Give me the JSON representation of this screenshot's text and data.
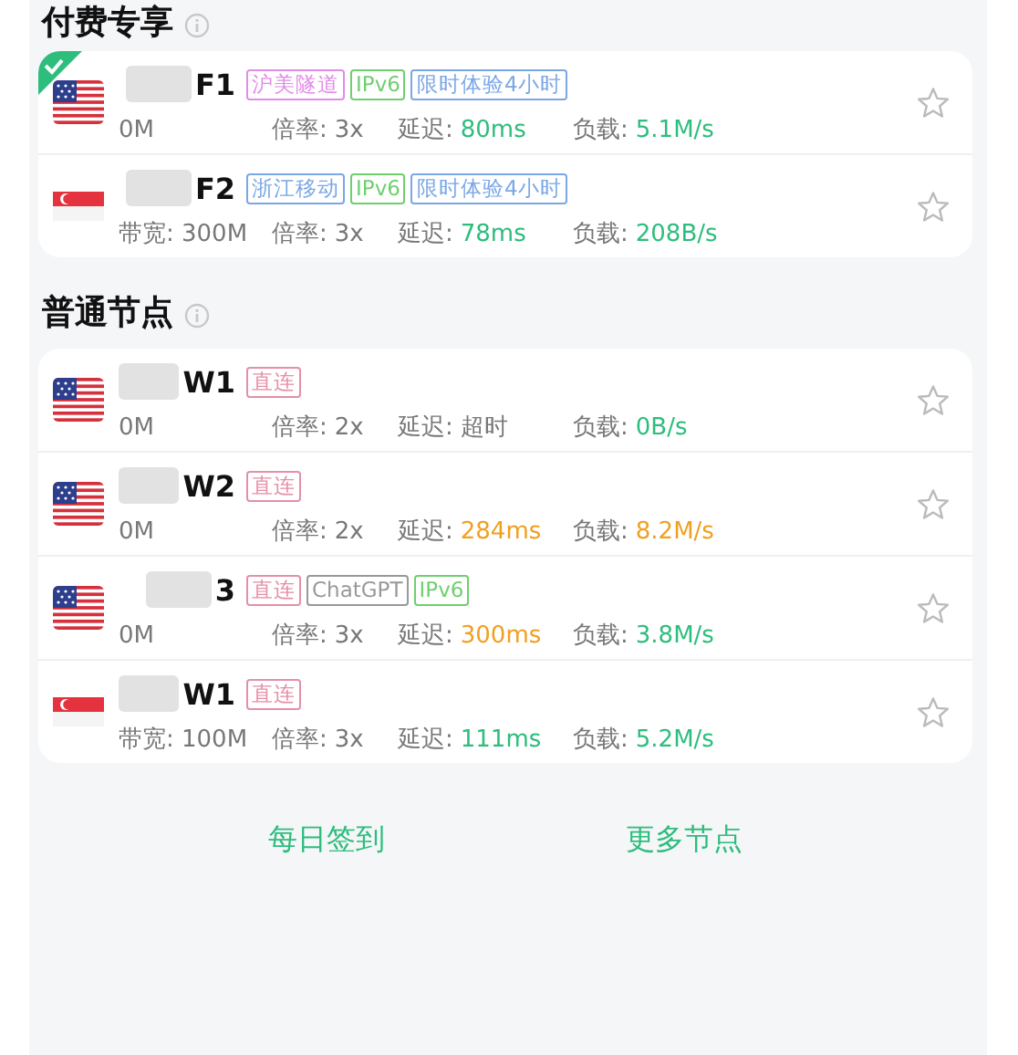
{
  "sections": [
    {
      "title": "付费专享",
      "nodes": [
        {
          "kind": "us",
          "selected": true,
          "name": "F1",
          "tags": [
            {
              "label": "沪美隧道",
              "color": "#e38be8"
            },
            {
              "label": "IPv6",
              "color": "#6fcf6f"
            },
            {
              "label": "限时体验4小时",
              "color": "#7aa7e6"
            }
          ],
          "bandwidth": "0M",
          "rate_label": "倍率:",
          "rate": "3x",
          "latency_label": "延迟:",
          "latency": {
            "text": "80ms",
            "color": "#2dbd7c"
          },
          "load_label": "负载:",
          "load": {
            "text": "5.1M/s",
            "color": "#2dbd7c"
          }
        },
        {
          "kind": "sg",
          "selected": false,
          "name": "F2",
          "tags": [
            {
              "label": "浙江移动",
              "color": "#7aa7e6"
            },
            {
              "label": "IPv6",
              "color": "#6fcf6f"
            },
            {
              "label": "限时体验4小时",
              "color": "#7aa7e6"
            }
          ],
          "bandwidth": "带宽: 300M",
          "rate_label": "倍率:",
          "rate": "3x",
          "latency_label": "延迟:",
          "latency": {
            "text": "78ms",
            "color": "#2dbd7c"
          },
          "load_label": "负载:",
          "load": {
            "text": "208B/s",
            "color": "#2dbd7c"
          }
        }
      ]
    },
    {
      "title": "普通节点",
      "nodes": [
        {
          "kind": "us",
          "selected": false,
          "name": "W1",
          "tags": [
            {
              "label": "直连",
              "color": "#e58fa8"
            }
          ],
          "bandwidth": "0M",
          "rate_label": "倍率:",
          "rate": "2x",
          "latency_label": "延迟:",
          "latency": {
            "text": "超时",
            "color": "#777777"
          },
          "load_label": "负载:",
          "load": {
            "text": "0B/s",
            "color": "#2dbd7c"
          }
        },
        {
          "kind": "us",
          "selected": false,
          "name": "W2",
          "tags": [
            {
              "label": "直连",
              "color": "#e58fa8"
            }
          ],
          "bandwidth": "0M",
          "rate_label": "倍率:",
          "rate": "2x",
          "latency_label": "延迟:",
          "latency": {
            "text": "284ms",
            "color": "#f0a020"
          },
          "load_label": "负载:",
          "load": {
            "text": "8.2M/s",
            "color": "#f0a020"
          }
        },
        {
          "kind": "us",
          "selected": false,
          "name": "3",
          "tags": [
            {
              "label": "直连",
              "color": "#e58fa8"
            },
            {
              "label": "ChatGPT",
              "color": "#999999"
            },
            {
              "label": "IPv6",
              "color": "#6fcf6f"
            }
          ],
          "bandwidth": "0M",
          "rate_label": "倍率:",
          "rate": "3x",
          "latency_label": "延迟:",
          "latency": {
            "text": "300ms",
            "color": "#f0a020"
          },
          "load_label": "负载:",
          "load": {
            "text": "3.8M/s",
            "color": "#2dbd7c"
          }
        },
        {
          "kind": "sg",
          "selected": false,
          "name": "W1",
          "tags": [
            {
              "label": "直连",
              "color": "#e58fa8"
            }
          ],
          "bandwidth": "带宽: 100M",
          "rate_label": "倍率:",
          "rate": "3x",
          "latency_label": "延迟:",
          "latency": {
            "text": "111ms",
            "color": "#2dbd7c"
          },
          "load_label": "负载:",
          "load": {
            "text": "5.2M/s",
            "color": "#2dbd7c"
          }
        }
      ]
    }
  ],
  "actions": [
    "每日签到",
    "更多节点"
  ]
}
